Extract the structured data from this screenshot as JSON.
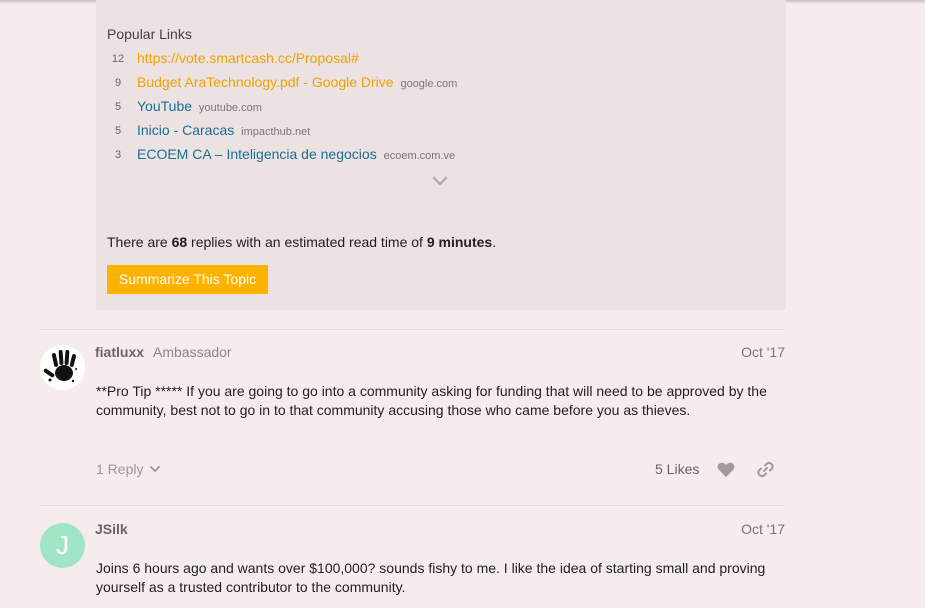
{
  "popular_links": {
    "title": "Popular Links",
    "items": [
      {
        "count": "12",
        "title": "https://vote.smartcash.cc/Proposal#",
        "domain": "",
        "color": "#f0a202"
      },
      {
        "count": "9",
        "title": "Budget AraTechnology.pdf - Google Drive",
        "domain": "google.com",
        "color": "#f0a202"
      },
      {
        "count": "5",
        "title": "YouTube",
        "domain": "youtube.com",
        "color": "#1a6f94"
      },
      {
        "count": "5",
        "title": "Inicio - Caracas",
        "domain": "impacthub.net",
        "color": "#1a6f94"
      },
      {
        "count": "3",
        "title": "ECOEM CA – Inteligencia de negocios",
        "domain": "ecoem.com.ve",
        "color": "#1a6f94"
      }
    ],
    "expand_icon": "chevron-down-icon"
  },
  "summary": {
    "prefix": "There are ",
    "replies": "68",
    "middle": " replies with an estimated read time of ",
    "read_time": "9 minutes",
    "suffix": ".",
    "button_label": "Summarize This Topic",
    "button_color": "#ffb100"
  },
  "posts": [
    {
      "username": "fiatluxx",
      "user_title": "Ambassador",
      "date": "Oct '17",
      "avatar_icon": "handprint-icon",
      "body": "**Pro Tip ***** If you are going to go into a community asking for funding that will need to be approved by the community, best not to go in to that community accusing those who came before you as thieves.",
      "reply_label": "1 Reply",
      "likes_label": "5 Likes"
    },
    {
      "username": "JSilk",
      "user_title": "",
      "date": "Oct '17",
      "avatar_letter": "J",
      "avatar_color": "#a2e5c6",
      "body": "Joins 6 hours ago and wants over $100,000? sounds fishy to me. I like the idea of starting small and proving yourself as a trusted contributor to the community."
    }
  ]
}
